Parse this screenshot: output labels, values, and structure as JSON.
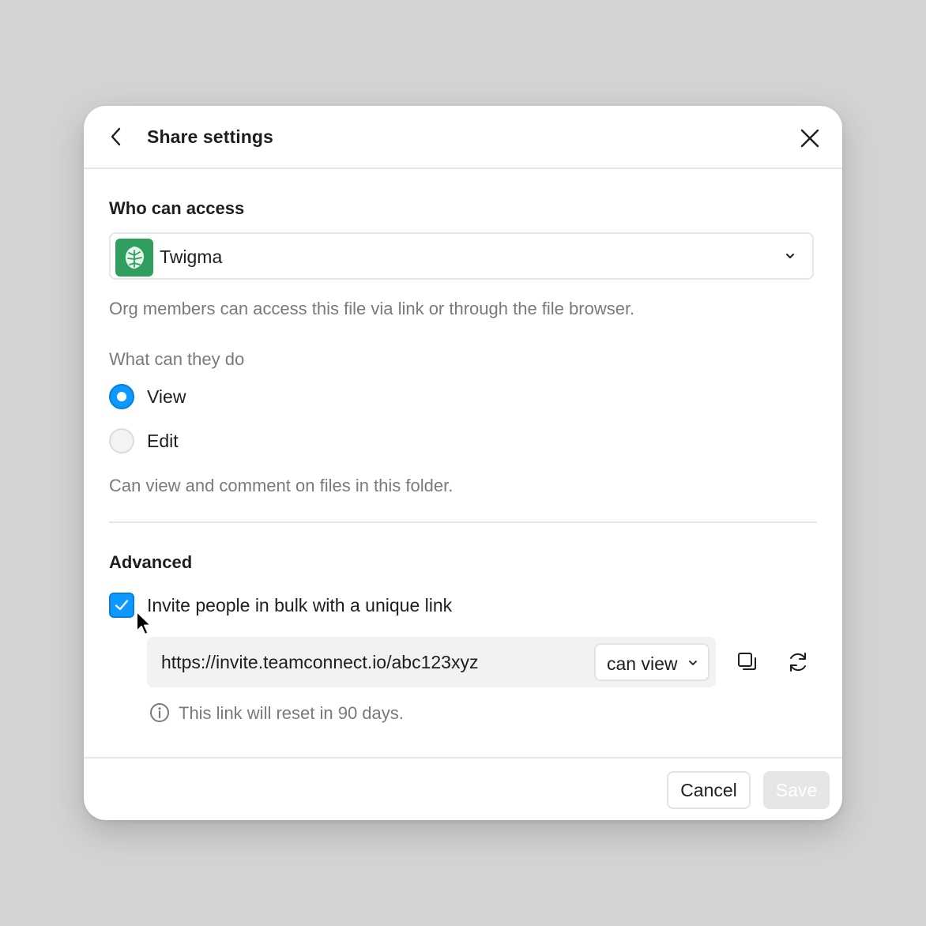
{
  "dialog": {
    "title": "Share settings",
    "back_icon": "chevron-left-icon",
    "close_icon": "close-icon"
  },
  "access": {
    "label": "Who can access",
    "org_name": "Twigma",
    "org_logo_color": "#2f9e5f",
    "helper": "Org members can access this file via link or through the file browser."
  },
  "permissions": {
    "label": "What can they do",
    "options": [
      {
        "label": "View",
        "selected": true
      },
      {
        "label": "Edit",
        "selected": false
      }
    ],
    "helper": "Can view and comment on files in this folder."
  },
  "advanced": {
    "label": "Advanced",
    "bulk_invite_label": "Invite people in bulk with a unique link",
    "bulk_invite_checked": true,
    "invite_link": "https://invite.teamconnect.io/abc123xyz",
    "link_permission": "can view",
    "reset_note": "This link will reset in 90 days."
  },
  "footer": {
    "cancel_label": "Cancel",
    "save_label": "Save",
    "save_enabled": false
  },
  "colors": {
    "accent": "#0d99ff",
    "background": "#d3d3d3",
    "muted_text": "#7a7a7a"
  }
}
